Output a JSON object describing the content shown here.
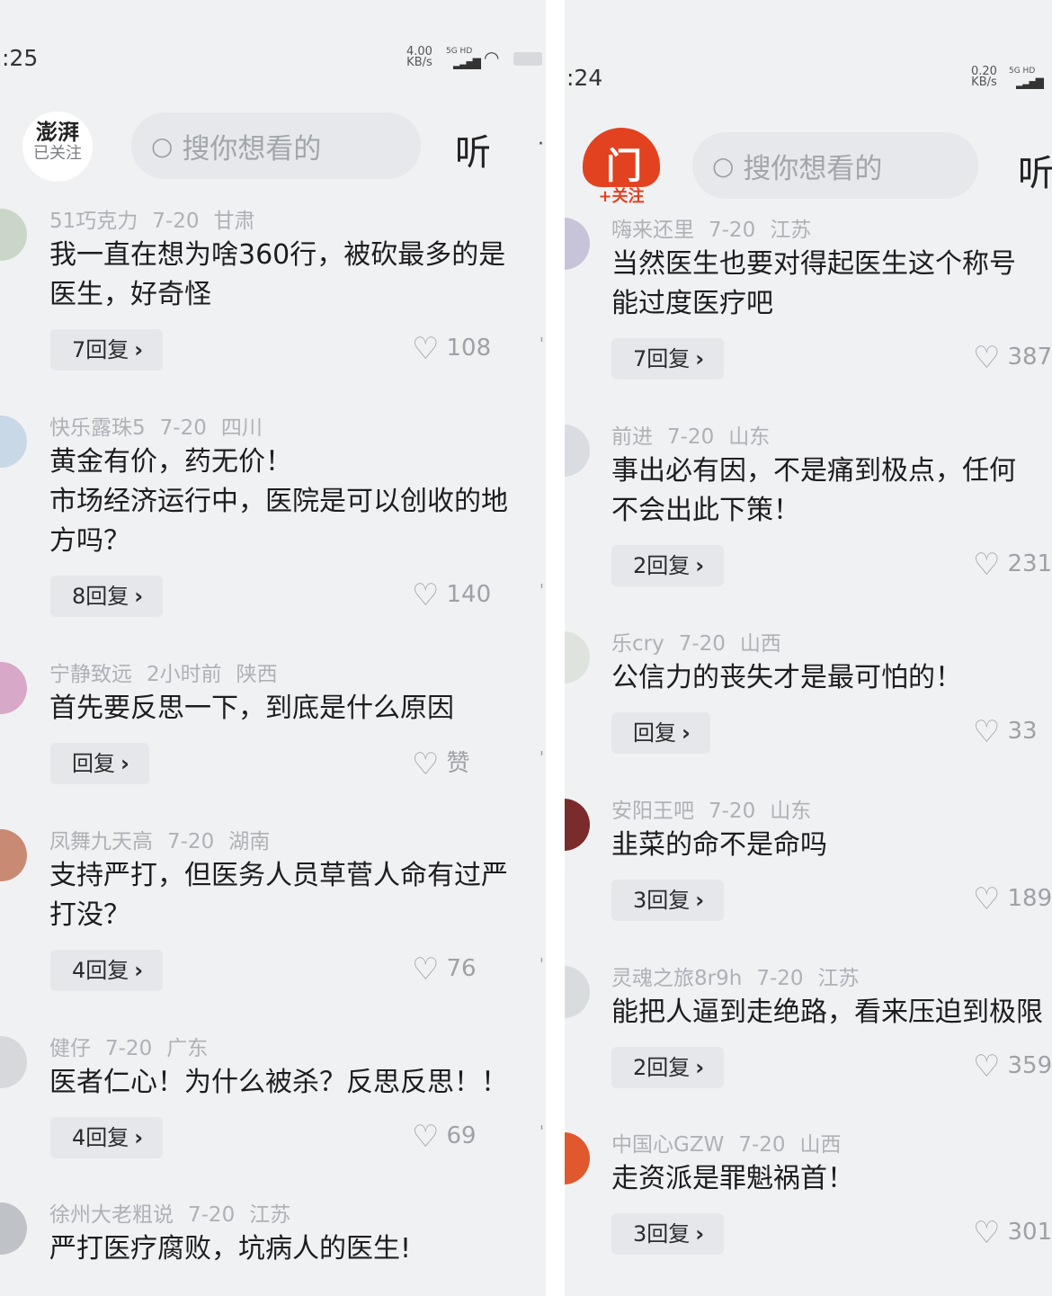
{
  "left": {
    "status": {
      "time": ":25",
      "speed_value": "4.00",
      "speed_unit": "KB/s",
      "network": "5G HD"
    },
    "header": {
      "logo_text": "澎湃",
      "follow_label": "已关注",
      "search_placeholder": "搜你想看的",
      "listen_label": "听",
      "more_glyph": "·"
    },
    "comments": [
      {
        "user": "51巧克力",
        "date": "7-20",
        "region": "甘肃",
        "lines": [
          "我一直在想为啥360行，被砍最多的是",
          "医生，好奇怪"
        ],
        "reply_label": "7回复",
        "likes": "108"
      },
      {
        "user": "快乐露珠5",
        "date": "7-20",
        "region": "四川",
        "lines": [
          "黄金有价，药无价！",
          "市场经济运行中，医院是可以创收的地",
          "方吗？"
        ],
        "reply_label": "8回复",
        "likes": "140"
      },
      {
        "user": "宁静致远",
        "date": "2小时前",
        "region": "陕西",
        "lines": [
          "首先要反思一下，到底是什么原因"
        ],
        "reply_label": "回复",
        "likes": "赞"
      },
      {
        "user": "凤舞九天高",
        "date": "7-20",
        "region": "湖南",
        "lines": [
          "支持严打，但医务人员草菅人命有过严",
          "打没？"
        ],
        "reply_label": "4回复",
        "likes": "76"
      },
      {
        "user": "健仔",
        "date": "7-20",
        "region": "广东",
        "lines": [
          "医者仁心！为什么被杀？反思反思！！"
        ],
        "reply_label": "4回复",
        "likes": "69"
      },
      {
        "user": "徐州大老粗说",
        "date": "7-20",
        "region": "江苏",
        "lines": [
          "严打医疗腐败，坑病人的医生!"
        ],
        "reply_label": "",
        "likes": ""
      }
    ]
  },
  "right": {
    "status": {
      "time": ":24",
      "speed_value": "0.20",
      "speed_unit": "KB/s",
      "network": "5G HD"
    },
    "header": {
      "logo_text": "门",
      "follow_label": "+关注",
      "search_placeholder": "搜你想看的",
      "listen_label": "听"
    },
    "comments": [
      {
        "user": "嗨来还里",
        "date": "7-20",
        "region": "江苏",
        "lines": [
          "当然医生也要对得起医生这个称号",
          "能过度医疗吧"
        ],
        "reply_label": "7回复",
        "likes": "387"
      },
      {
        "user": "前进",
        "date": "7-20",
        "region": "山东",
        "lines": [
          "事出必有因，不是痛到极点，任何",
          "不会出此下策！"
        ],
        "reply_label": "2回复",
        "likes": "231"
      },
      {
        "user": "乐cry",
        "date": "7-20",
        "region": "山西",
        "lines": [
          "公信力的丧失才是最可怕的！"
        ],
        "reply_label": "回复",
        "likes": "33"
      },
      {
        "user": "安阳王吧",
        "date": "7-20",
        "region": "山东",
        "lines": [
          "韭菜的命不是命吗"
        ],
        "reply_label": "3回复",
        "likes": "189"
      },
      {
        "user": "灵魂之旅8r9h",
        "date": "7-20",
        "region": "江苏",
        "lines": [
          "能把人逼到走绝路，看来压迫到极限"
        ],
        "reply_label": "2回复",
        "likes": "359"
      },
      {
        "user": "中国心GZW",
        "date": "7-20",
        "region": "山西",
        "lines": [
          "走资派是罪魁祸首！"
        ],
        "reply_label": "3回复",
        "likes": "301"
      }
    ]
  },
  "icons": {
    "search": "search-icon",
    "heart": "heart-icon",
    "chevron": "chevron-right-icon",
    "wifi": "wifi-icon",
    "battery": "battery-icon",
    "signal": "signal-icon"
  },
  "colors": {
    "background": "#f0f1f3",
    "meta_text": "#aeb1b6",
    "body_text": "#1d1d1f",
    "reply_chip": "#e5e7ea",
    "brand_red": "#e2421f"
  }
}
